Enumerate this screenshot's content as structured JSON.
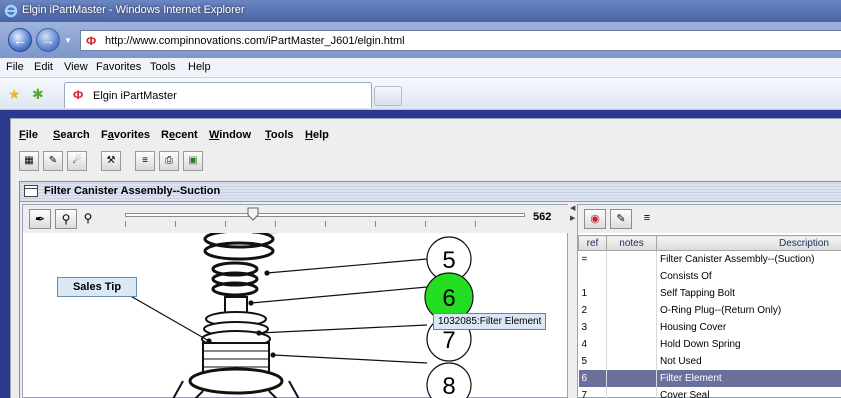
{
  "window": {
    "title": "Elgin iPartMaster - Windows Internet Explorer"
  },
  "address": {
    "url": "http://www.compinnovations.com/iPartMaster_J601/elgin.html"
  },
  "browser_menu": [
    "File",
    "Edit",
    "View",
    "Favorites",
    "Tools",
    "Help"
  ],
  "tab": {
    "label": "Elgin iPartMaster"
  },
  "app_menu": [
    {
      "label": "File",
      "mnemonic": "F"
    },
    {
      "label": "Search",
      "mnemonic": "S"
    },
    {
      "label": "Favorites",
      "mnemonic": "a"
    },
    {
      "label": "Recent",
      "mnemonic": "e"
    },
    {
      "label": "Window",
      "mnemonic": "W"
    },
    {
      "label": "Tools",
      "mnemonic": "T"
    },
    {
      "label": "Help",
      "mnemonic": "H"
    }
  ],
  "frame": {
    "title": "Filter Canister Assembly--Suction"
  },
  "viewer": {
    "zoom": "562",
    "zoom_slider_fraction": 0.32,
    "sales_tip": "Sales Tip",
    "tooltip": "1032085:Filter Element",
    "callouts": [
      "5",
      "6",
      "7",
      "8"
    ],
    "highlight_callout": "6",
    "highlight_color": "#22dd22"
  },
  "parts_table": {
    "headers": {
      "ref": "ref",
      "notes": "notes",
      "description": "Description"
    },
    "rows": [
      {
        "ref": "=",
        "notes": "",
        "description": "Filter Canister Assembly--(Suction)"
      },
      {
        "ref": "",
        "notes": "",
        "description": "Consists Of"
      },
      {
        "ref": "1",
        "notes": "",
        "description": "Self Tapping Bolt"
      },
      {
        "ref": "2",
        "notes": "",
        "description": "O-Ring Plug--(Return Only)"
      },
      {
        "ref": "3",
        "notes": "",
        "description": "Housing Cover"
      },
      {
        "ref": "4",
        "notes": "",
        "description": "Hold Down Spring"
      },
      {
        "ref": "5",
        "notes": "",
        "description": "Not Used"
      },
      {
        "ref": "6",
        "notes": "",
        "description": "Filter Element",
        "selected": true
      },
      {
        "ref": "7",
        "notes": "",
        "description": "Cover Seal"
      }
    ],
    "selected_color": "#6a6f9c"
  }
}
